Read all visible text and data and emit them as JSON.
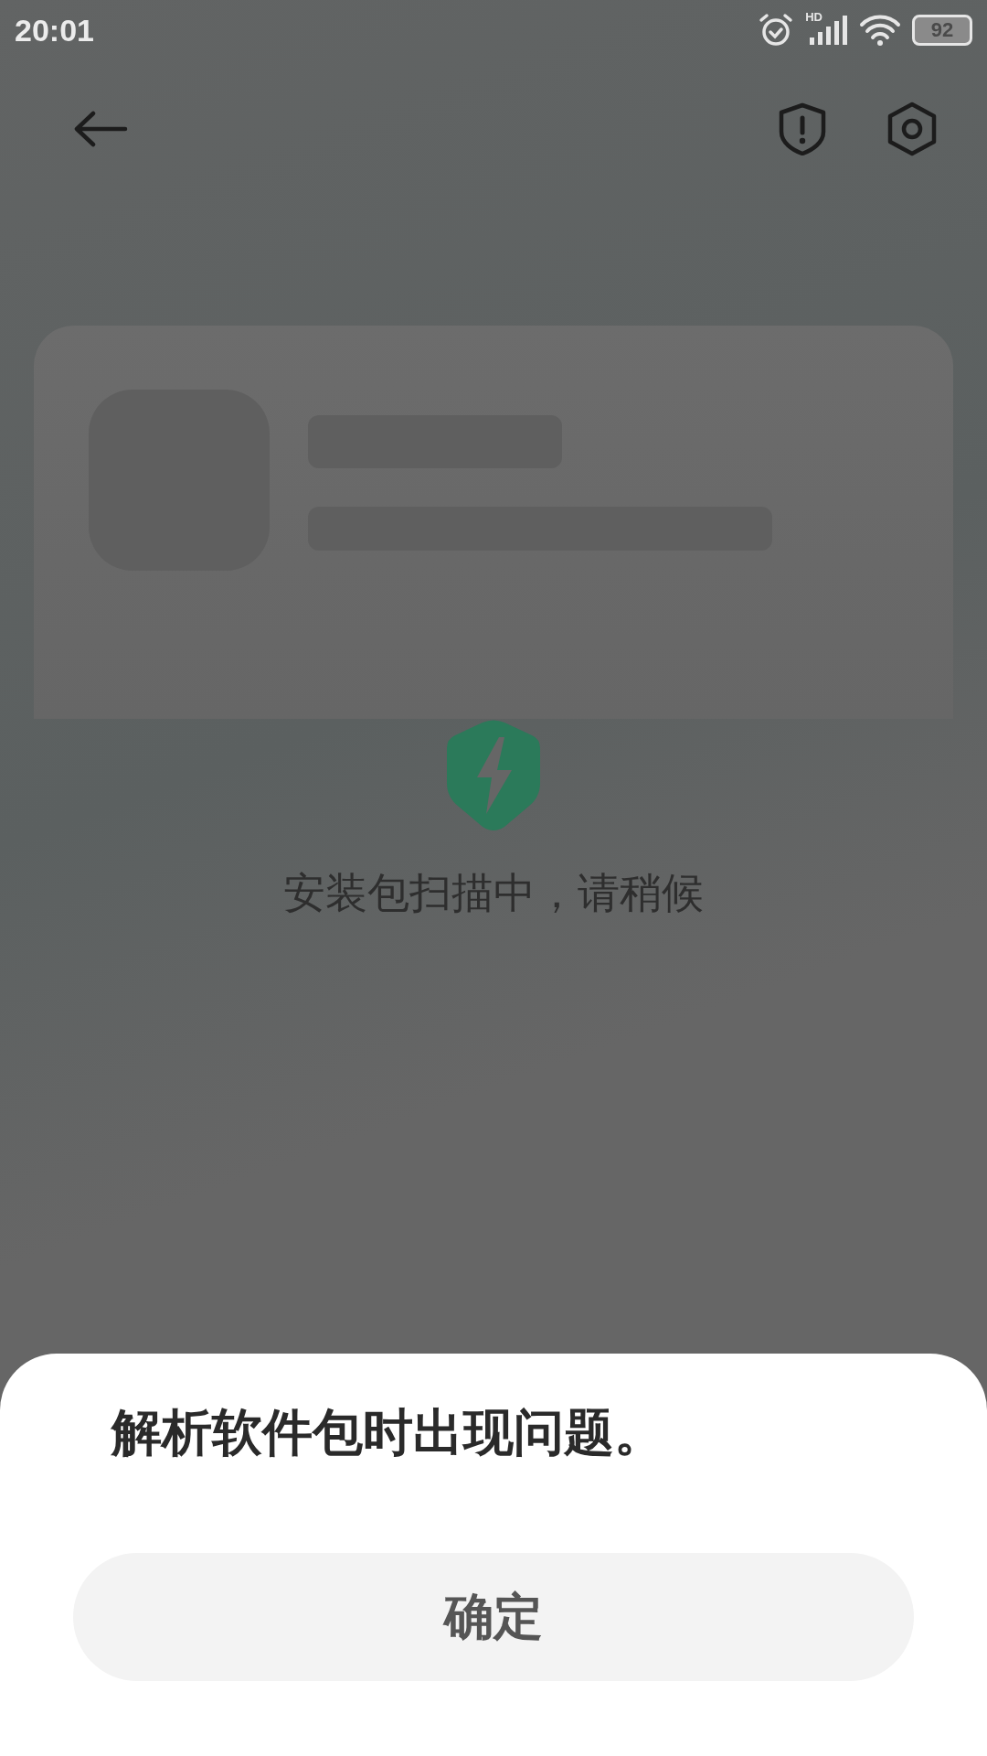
{
  "status_bar": {
    "time": "20:01",
    "network": "HD",
    "battery": "92"
  },
  "scan": {
    "message": "安装包扫描中，请稍候"
  },
  "dialog": {
    "message": "解析软件包时出现问题。",
    "buttons": [
      {
        "label": "确定"
      }
    ]
  }
}
